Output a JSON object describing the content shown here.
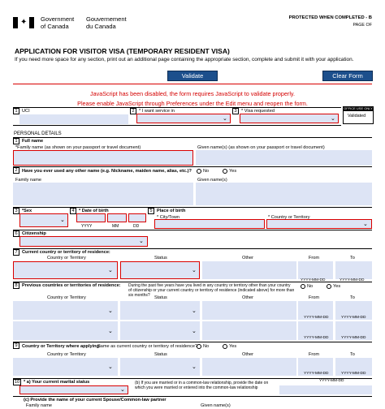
{
  "header": {
    "gov_en_line1": "Government",
    "gov_en_line2": "of Canada",
    "gov_fr_line1": "Gouvernement",
    "gov_fr_line2": "du Canada",
    "protected": "PROTECTED WHEN COMPLETED - B",
    "page_of": "PAGE OF"
  },
  "form": {
    "title": "APPLICATION FOR VISITOR VISA (TEMPORARY RESIDENT VISA)",
    "instructions": "If you need more space for any section, print out an additional page containing the appropriate section, complete and submit it with your application.",
    "validate_label": "Validate",
    "clear_label": "Clear Form",
    "js_warning_1": "JavaScript has been disabled, the form requires JavaScript to validate properly.",
    "js_warning_2": "Please enable JavaScript through Preferences under the Edit menu and reopen the form."
  },
  "row1": {
    "n1": "1",
    "uci_label": "UCI",
    "n2": "2",
    "service_label": "* I want service in",
    "n3": "3",
    "visa_label": "* Visa requested",
    "office_label": "OFFICE USE ONLY",
    "validated_label": "Validated"
  },
  "personal": {
    "section_title": "PERSONAL DETAILS",
    "n1": "1",
    "full_name": "Full name",
    "family_name": "*Family name  (as shown on your passport or travel document)",
    "given_names": "Given name(s)  (as shown on your passport or travel document)",
    "n2": "2",
    "other_name_q": "Have you ever used any other name (e.g. Nickname, maiden name, alias, etc.)?",
    "no": "No",
    "yes": "Yes",
    "other_family": "Family name",
    "other_given": "Given name(s)",
    "n3": "3",
    "sex": "*Sex",
    "n4": "4",
    "dob": "* Date of birth",
    "yyyy": "YYYY",
    "mm": "MM",
    "dd": "DD",
    "n5": "5",
    "pob": "Place of birth",
    "city": "* City/Town",
    "country": "* Country or Territory",
    "n6": "6",
    "citizenship": "Citizenship",
    "n7": "7",
    "residence": "Current country or territory of residence:",
    "col_country": "Country or Territory",
    "col_status": "Status",
    "col_other": "Other",
    "col_from": "From",
    "col_to": "To",
    "date_fmt": "YYYY-MM-DD",
    "n8": "8",
    "prev_countries": "Previous countries or territories of residence:",
    "prev_text": "During the past five years have you lived in any country or territory other than your country of citizenship or your current country or territory of residence (indicated above) for more than six months?",
    "n9": "9",
    "applying": "Country or Territory where applying:",
    "same_as": "Same as current country or territory of residence?",
    "n10": "10",
    "marital": "* a) Your current marital status",
    "married_q": "(b) If you are married or in a common-law relationship, provide the date on which you were married or entered into the common-law relationship",
    "spouse": "(c) Provide the name of your current Spouse/Common-law partner",
    "spouse_family": "Family name",
    "spouse_given": "Given name(s)"
  }
}
